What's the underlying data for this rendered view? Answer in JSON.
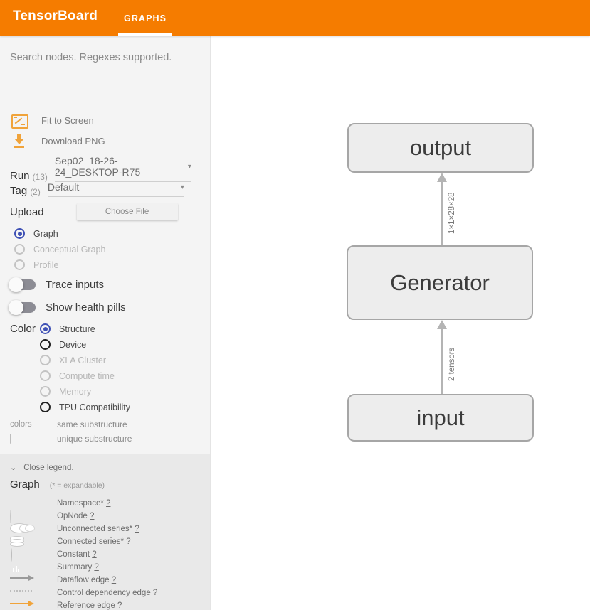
{
  "header": {
    "brand": "TensorBoard",
    "tabs": [
      {
        "label": "GRAPHS",
        "active": true
      }
    ]
  },
  "sidebar": {
    "search": {
      "placeholder": "Search nodes. Regexes supported.",
      "value": ""
    },
    "actions": [
      {
        "label": "Fit to Screen",
        "icon": "fit-to-screen-icon"
      },
      {
        "label": "Download PNG",
        "icon": "download-icon"
      }
    ],
    "run_selector": {
      "label": "Run",
      "count": "(13)",
      "value": "Sep02_18-26-24_DESKTOP-R75",
      "caret": "▾"
    },
    "tag_selector": {
      "label": "Tag",
      "count": "(2)",
      "value": "Default",
      "caret": "▾"
    },
    "upload": {
      "label": "Upload",
      "button_label": "Choose File"
    },
    "graph_type_options": [
      {
        "label": "Graph",
        "selected": true,
        "disabled": false
      },
      {
        "label": "Conceptual Graph",
        "selected": false,
        "disabled": true
      },
      {
        "label": "Profile",
        "selected": false,
        "disabled": true
      }
    ],
    "toggles": [
      {
        "label": "Trace inputs",
        "on": false
      },
      {
        "label": "Show health pills",
        "on": false
      }
    ],
    "color": {
      "label": "Color",
      "options": [
        {
          "label": "Structure",
          "selected": true,
          "disabled": false
        },
        {
          "label": "Device",
          "selected": false,
          "disabled": false
        },
        {
          "label": "XLA Cluster",
          "selected": false,
          "disabled": true
        },
        {
          "label": "Compute time",
          "selected": false,
          "disabled": true
        },
        {
          "label": "Memory",
          "selected": false,
          "disabled": true
        },
        {
          "label": "TPU Compatibility",
          "selected": false,
          "disabled": false
        }
      ],
      "swatch_key": "colors",
      "same_substructure": "same substructure",
      "unique_substructure": "unique substructure"
    }
  },
  "legend": {
    "close_label": "Close legend.",
    "chevron": "⌄",
    "title": "Graph",
    "note": "(* = expandable)",
    "items": [
      {
        "label": "Namespace*",
        "help": "?",
        "icon": "namespace-icon"
      },
      {
        "label": "OpNode",
        "help": "?",
        "icon": "opnode-icon"
      },
      {
        "label": "Unconnected series*",
        "help": "?",
        "icon": "unconnected-series-icon"
      },
      {
        "label": "Connected series*",
        "help": "?",
        "icon": "connected-series-icon"
      },
      {
        "label": "Constant",
        "help": "?",
        "icon": "constant-icon"
      },
      {
        "label": "Summary",
        "help": "?",
        "icon": "summary-icon"
      },
      {
        "label": "Dataflow edge",
        "help": "?",
        "icon": "dataflow-edge-icon"
      },
      {
        "label": "Control dependency edge",
        "help": "?",
        "icon": "control-dependency-edge-icon"
      },
      {
        "label": "Reference edge",
        "help": "?",
        "icon": "reference-edge-icon"
      }
    ]
  },
  "graph": {
    "nodes": [
      {
        "id": "output",
        "label": "output"
      },
      {
        "id": "generator",
        "label": "Generator"
      },
      {
        "id": "input",
        "label": "input"
      }
    ],
    "edges": [
      {
        "from": "generator",
        "to": "output",
        "label": "1×1×28×28"
      },
      {
        "from": "input",
        "to": "generator",
        "label": "2 tensors"
      }
    ]
  },
  "colors": {
    "accent": "#f57c00",
    "radio_selected": "#3f51b5",
    "node_fill": "#ededed",
    "node_border": "#a6a6a6",
    "edge": "#b4b4b4"
  }
}
